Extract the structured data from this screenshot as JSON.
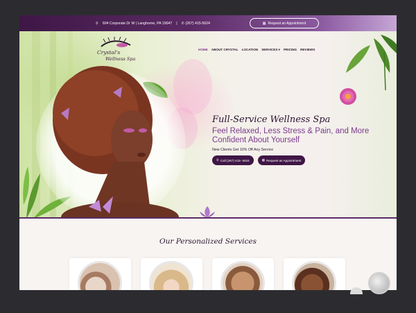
{
  "topbar": {
    "address": "604 Corporate Dr W | Langhorne, PA 19047",
    "separator": "|",
    "phone": "(267) 415-5624",
    "request_label": "Request an Appointment"
  },
  "logo": {
    "line1": "Crystal's",
    "line2": "Wellness Spa"
  },
  "nav": [
    "HOME",
    "ABOUT CRYSTAL",
    "LOCATION",
    "SERVICES ▾",
    "PRICING",
    "REVIEWS"
  ],
  "hero": {
    "title": "Full-Service Wellness Spa",
    "subtitle": "Feel Relaxed, Less Stress & Pain, and More Confident About Yourself",
    "offer": "New Clients Get 10% Off Any Service",
    "call_label": "Call (267) 415- 5624",
    "request_label": "Request an Appointment"
  },
  "services": {
    "title": "Our Personalized Services"
  },
  "icons": {
    "map_pin": "map-pin-icon",
    "phone": "phone-icon",
    "calendar": "calendar-icon"
  },
  "colors": {
    "brand_purple": "#3e1746",
    "accent_violet": "#7b3b8c"
  }
}
